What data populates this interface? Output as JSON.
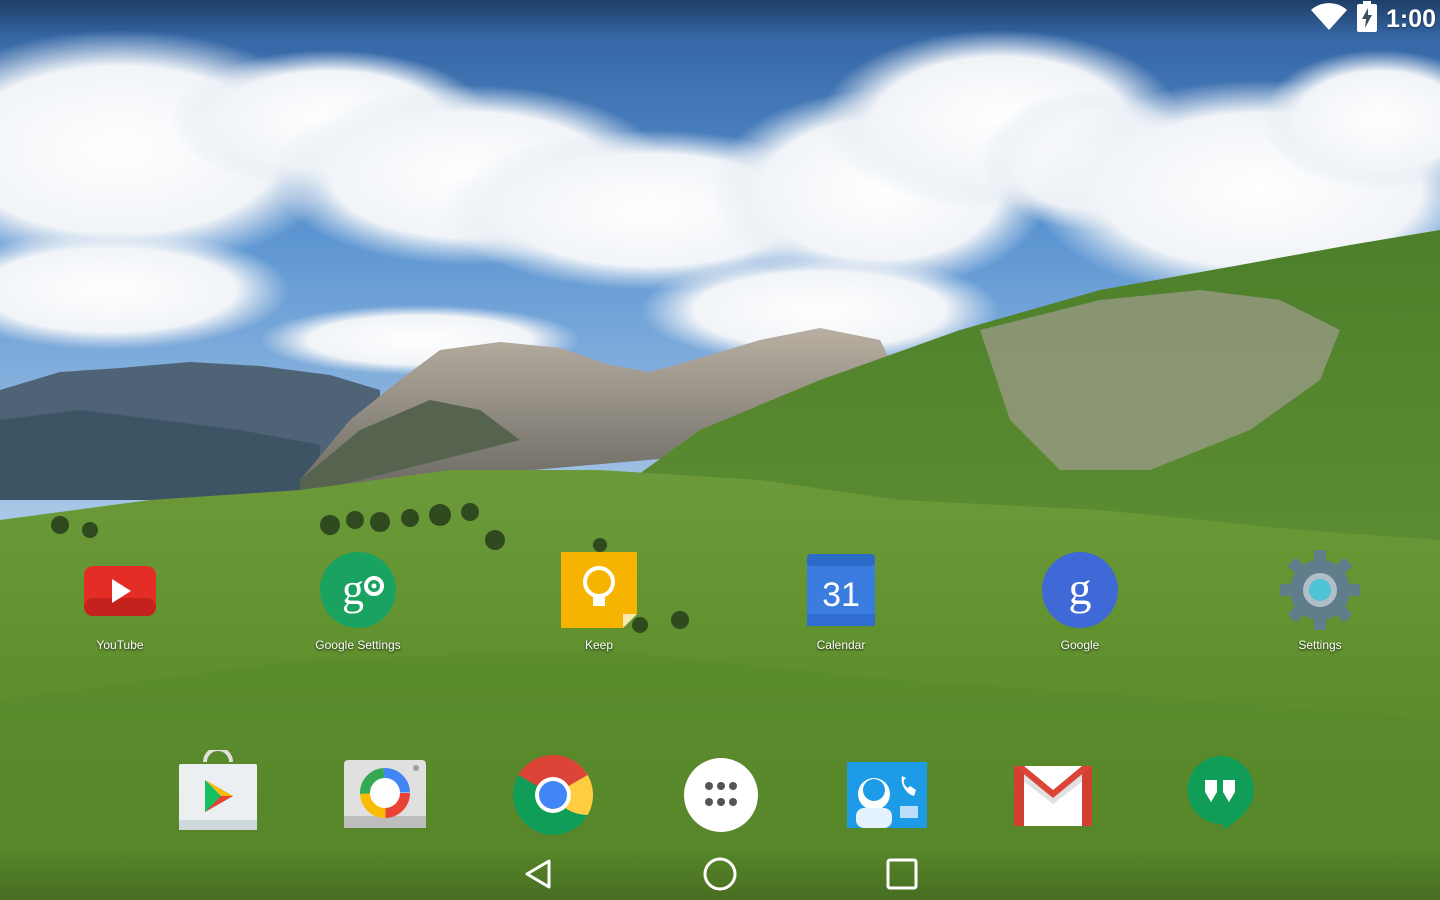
{
  "status_bar": {
    "time": "1:00",
    "wifi_icon": "wifi-icon",
    "battery_icon": "battery-charging-icon"
  },
  "home_apps": [
    {
      "label": "YouTube",
      "icon": "youtube-icon"
    },
    {
      "label": "Google Settings",
      "icon": "google-settings-icon"
    },
    {
      "label": "Keep",
      "icon": "keep-icon"
    },
    {
      "label": "Calendar",
      "icon": "calendar-icon",
      "icon_text": "31"
    },
    {
      "label": "Google",
      "icon": "google-icon"
    },
    {
      "label": "Settings",
      "icon": "settings-icon"
    }
  ],
  "dock": [
    {
      "icon": "play-store-icon"
    },
    {
      "icon": "photos-icon"
    },
    {
      "icon": "chrome-icon"
    },
    {
      "icon": "app-drawer-icon"
    },
    {
      "icon": "phone-contacts-icon"
    },
    {
      "icon": "gmail-icon"
    },
    {
      "icon": "hangouts-icon"
    }
  ],
  "nav_bar": {
    "back": "back-icon",
    "home": "home-icon",
    "recents": "recents-icon"
  },
  "colors": {
    "sky": "#3f7fc4",
    "grass": "#6f9a36",
    "youtube_red": "#e52d27",
    "settings_green": "#1aa261",
    "keep_yellow": "#f6b400",
    "calendar_blue": "#3a7dde",
    "google_blue": "#3f69d6",
    "settings_gray": "#607d8b"
  }
}
